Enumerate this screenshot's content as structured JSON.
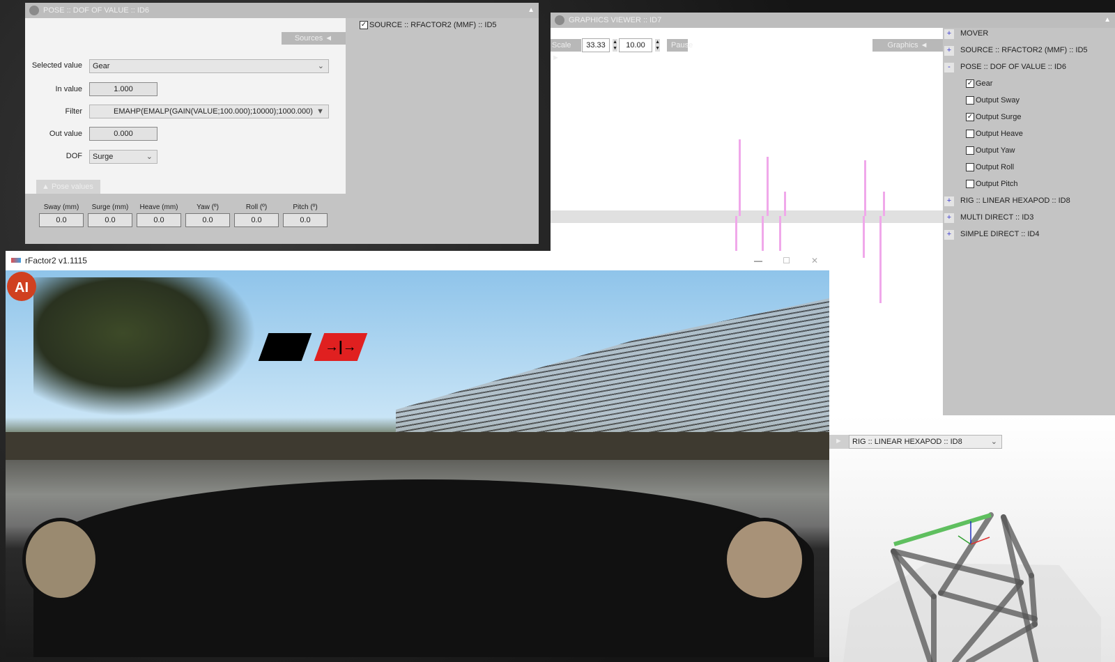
{
  "pose_panel": {
    "title": "POSE :: DOF OF VALUE :: ID6",
    "sources_button": "Sources ◄",
    "source_item": {
      "label": "SOURCE :: RFACTOR2 (MMF) :: ID5",
      "checked": true
    },
    "selected_value_label": "Selected value",
    "selected_value": "Gear",
    "in_value_label": "In value",
    "in_value": "1.000",
    "filter_label": "Filter",
    "filter": "EMAHP(EMALP(GAIN(VALUE;100.000);10000);1000.000)",
    "out_value_label": "Out value",
    "out_value": "0.000",
    "dof_label": "DOF",
    "dof": "Surge",
    "pose_values_tab": "▲  Pose values",
    "pose_values": [
      {
        "label": "Sway (mm)",
        "value": "0.0"
      },
      {
        "label": "Surge (mm)",
        "value": "0.0"
      },
      {
        "label": "Heave (mm)",
        "value": "0.0"
      },
      {
        "label": "Yaw (º)",
        "value": "0.0"
      },
      {
        "label": "Roll (º)",
        "value": "0.0"
      },
      {
        "label": "Pitch (º)",
        "value": "0.0"
      }
    ]
  },
  "graphics_viewer": {
    "title": "GRAPHICS VIEWER :: ID7",
    "scale_button": "Scale ►",
    "scale_value": "33.33",
    "second_value": "10.00",
    "pause_button": "Pause",
    "graphics_button": "Graphics ◄",
    "tree": [
      {
        "sign": "+",
        "label": "MOVER"
      },
      {
        "sign": "+",
        "label": "SOURCE :: RFACTOR2 (MMF) :: ID5"
      },
      {
        "sign": "-",
        "label": "POSE :: DOF OF VALUE :: ID6"
      },
      {
        "sign": "+",
        "label": "RIG :: LINEAR HEXAPOD :: ID8"
      },
      {
        "sign": "+",
        "label": "MULTI DIRECT :: ID3"
      },
      {
        "sign": "+",
        "label": "SIMPLE DIRECT :: ID4"
      }
    ],
    "channels": [
      {
        "label": "Gear",
        "checked": true
      },
      {
        "label": "Output Sway",
        "checked": false
      },
      {
        "label": "Output Surge",
        "checked": true
      },
      {
        "label": "Output Heave",
        "checked": false
      },
      {
        "label": "Output Yaw",
        "checked": false
      },
      {
        "label": "Output Roll",
        "checked": false
      },
      {
        "label": "Output Pitch",
        "checked": false
      }
    ],
    "trace_color": "#f0a8ea"
  },
  "rfactor": {
    "title": "rFactor2 v1.1115",
    "logo_text": "AI",
    "hud_arrow": "→|→"
  },
  "hexapod": {
    "selector": "RIG :: LINEAR HEXAPOD :: ID8",
    "play": "►"
  }
}
